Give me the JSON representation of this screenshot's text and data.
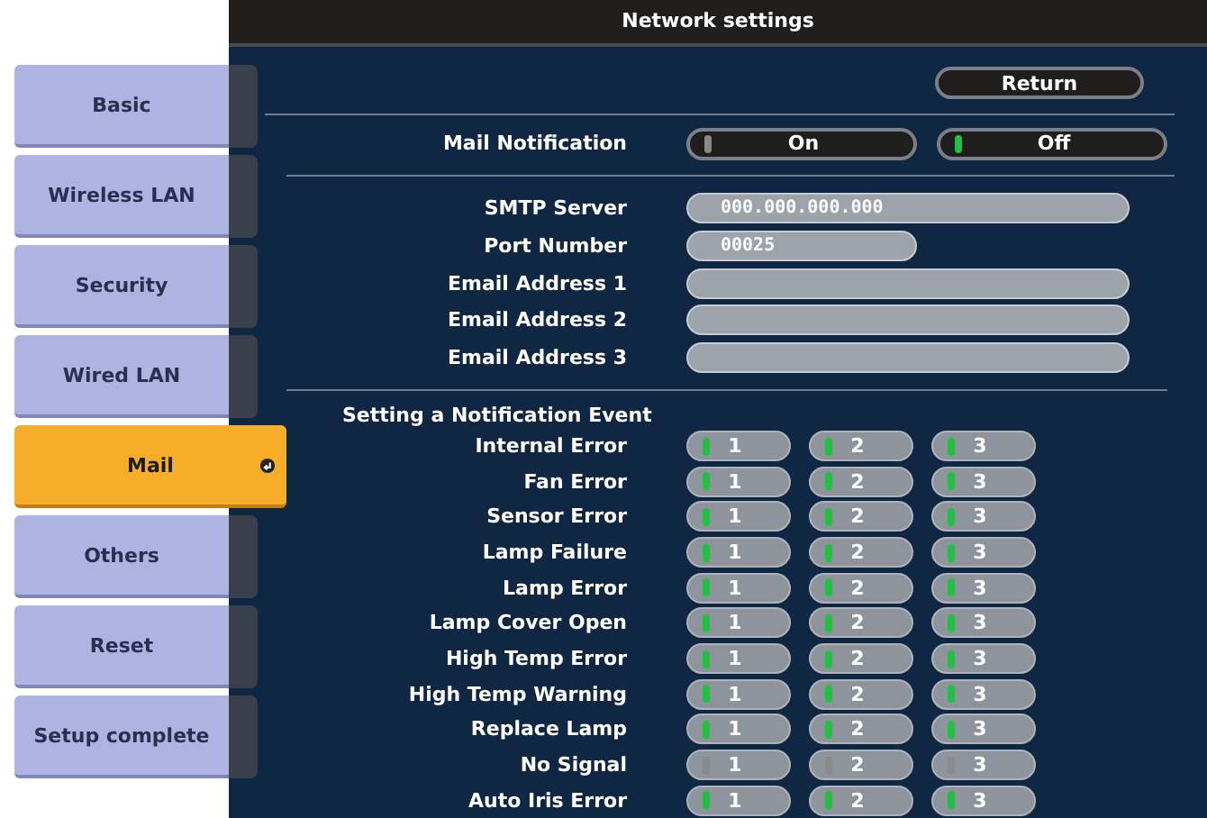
{
  "window": {
    "title": "Network settings"
  },
  "sidebar": {
    "items": [
      {
        "label": "Basic",
        "selected": false
      },
      {
        "label": "Wireless LAN",
        "selected": false
      },
      {
        "label": "Security",
        "selected": false
      },
      {
        "label": "Wired LAN",
        "selected": false
      },
      {
        "label": "Mail",
        "selected": true
      },
      {
        "label": "Others",
        "selected": false
      },
      {
        "label": "Reset",
        "selected": false
      },
      {
        "label": "Setup complete",
        "selected": false
      }
    ]
  },
  "return_button": "Return",
  "mail_notification": {
    "label": "Mail Notification",
    "options": [
      {
        "label": "On",
        "selected": false
      },
      {
        "label": "Off",
        "selected": true
      }
    ]
  },
  "fields": [
    {
      "label": "SMTP Server",
      "value": "000.000.000.000",
      "kind": "wide"
    },
    {
      "label": "Port Number",
      "value": "00025",
      "kind": "short"
    },
    {
      "label": "Email Address 1",
      "kind": "wide"
    },
    {
      "label": "Email Address 2",
      "kind": "wide"
    },
    {
      "label": "Email Address 3",
      "kind": "wide"
    }
  ],
  "events": {
    "title": "Setting a Notification Event",
    "rows": [
      {
        "label": "Internal Error",
        "channels": [
          {
            "label": "1",
            "on": true
          },
          {
            "label": "2",
            "on": true
          },
          {
            "label": "3",
            "on": true
          }
        ]
      },
      {
        "label": "Fan Error",
        "channels": [
          {
            "label": "1",
            "on": true
          },
          {
            "label": "2",
            "on": true
          },
          {
            "label": "3",
            "on": true
          }
        ]
      },
      {
        "label": "Sensor Error",
        "channels": [
          {
            "label": "1",
            "on": true
          },
          {
            "label": "2",
            "on": true
          },
          {
            "label": "3",
            "on": true
          }
        ]
      },
      {
        "label": "Lamp Failure",
        "channels": [
          {
            "label": "1",
            "on": true
          },
          {
            "label": "2",
            "on": true
          },
          {
            "label": "3",
            "on": true
          }
        ]
      },
      {
        "label": "Lamp Error",
        "channels": [
          {
            "label": "1",
            "on": true
          },
          {
            "label": "2",
            "on": true
          },
          {
            "label": "3",
            "on": true
          }
        ]
      },
      {
        "label": "Lamp Cover Open",
        "channels": [
          {
            "label": "1",
            "on": true
          },
          {
            "label": "2",
            "on": true
          },
          {
            "label": "3",
            "on": true
          }
        ]
      },
      {
        "label": "High Temp Error",
        "channels": [
          {
            "label": "1",
            "on": true
          },
          {
            "label": "2",
            "on": true
          },
          {
            "label": "3",
            "on": true
          }
        ]
      },
      {
        "label": "High Temp Warning",
        "channels": [
          {
            "label": "1",
            "on": true
          },
          {
            "label": "2",
            "on": true
          },
          {
            "label": "3",
            "on": true
          }
        ]
      },
      {
        "label": "Replace Lamp",
        "channels": [
          {
            "label": "1",
            "on": true
          },
          {
            "label": "2",
            "on": true
          },
          {
            "label": "3",
            "on": true
          }
        ]
      },
      {
        "label": "No Signal",
        "channels": [
          {
            "label": "1",
            "on": false
          },
          {
            "label": "2",
            "on": false
          },
          {
            "label": "3",
            "on": false
          }
        ]
      },
      {
        "label": "Auto Iris Error",
        "channels": [
          {
            "label": "1",
            "on": true
          },
          {
            "label": "2",
            "on": true
          },
          {
            "label": "3",
            "on": true
          }
        ]
      }
    ]
  }
}
